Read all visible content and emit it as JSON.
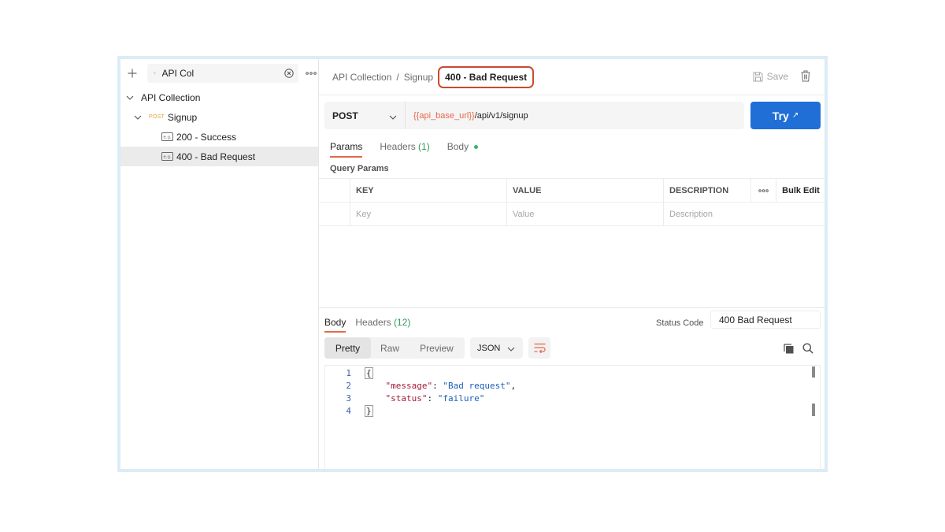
{
  "sidebar": {
    "search": {
      "value": "API Col"
    },
    "tree": {
      "collection": "API Collection",
      "request": {
        "method": "POST",
        "name": "Signup"
      },
      "examples": [
        {
          "label": "200 - Success"
        },
        {
          "label": "400 - Bad Request"
        }
      ]
    }
  },
  "header": {
    "breadcrumb": [
      "API Collection",
      "Signup"
    ],
    "active_crumb": "400 - Bad Request",
    "save_label": "Save"
  },
  "request": {
    "method": "POST",
    "url_variable": "{{api_base_url}}",
    "url_path": "/api/v1/signup",
    "try_label": "Try",
    "tabs": {
      "params": "Params",
      "headers": "Headers",
      "headers_count": "(1)",
      "body": "Body"
    },
    "query_params_label": "Query Params",
    "table": {
      "headers": {
        "key": "KEY",
        "value": "VALUE",
        "description": "DESCRIPTION",
        "bulk_edit": "Bulk Edit"
      },
      "placeholders": {
        "key": "Key",
        "value": "Value",
        "description": "Description"
      }
    }
  },
  "response": {
    "tabs": {
      "body": "Body",
      "headers": "Headers",
      "headers_count": "(12)"
    },
    "status_label": "Status Code",
    "status_value": "400 Bad Request",
    "views": {
      "pretty": "Pretty",
      "raw": "Raw",
      "preview": "Preview"
    },
    "format": "JSON",
    "code": {
      "line_numbers": [
        "1",
        "2",
        "3",
        "4"
      ],
      "open_brace": "{",
      "close_brace": "}",
      "line2_key": "\"message\"",
      "line2_sep": ": ",
      "line2_val": "\"Bad request\"",
      "line2_end": ",",
      "line3_key": "\"status\"",
      "line3_sep": ": ",
      "line3_val": "\"failure\""
    }
  },
  "colors": {
    "accent": "#e4694a",
    "primary_button": "#1f6fd6",
    "count_green": "#2f9b57",
    "post_method": "#e6a23c"
  }
}
